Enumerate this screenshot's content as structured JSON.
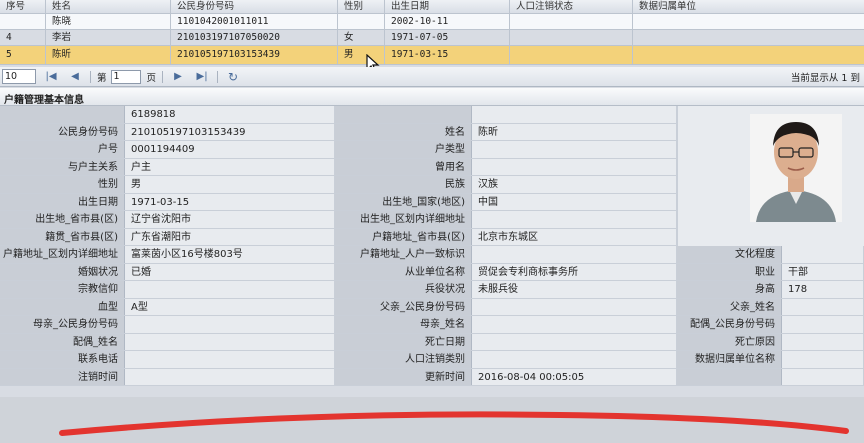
{
  "grid": {
    "headers": [
      "序号",
      "姓名",
      "公民身份号码",
      "性别",
      "出生日期",
      "人口注销状态",
      "数据归属单位"
    ],
    "rows": [
      {
        "idx": "",
        "name": "陈晓",
        "id": "1101042001011011",
        "sex": "",
        "dob": "2002-10-11",
        "status": "",
        "unit": ""
      },
      {
        "idx": "4",
        "name": "李岩",
        "id": "210103197107050020",
        "sex": "女",
        "dob": "1971-07-05",
        "status": "",
        "unit": ""
      },
      {
        "idx": "5",
        "name": "陈昕",
        "id": "210105197103153439",
        "sex": "男",
        "dob": "1971-03-15",
        "status": "",
        "unit": ""
      }
    ]
  },
  "pager": {
    "page_size": "10",
    "page_label": "第",
    "page_value": "1",
    "page_suffix": "页",
    "info": "当前显示从 1 到"
  },
  "section_title": "户籍管理基本信息",
  "form": [
    [
      {
        "l": "",
        "v": "6189818"
      },
      {
        "l": "",
        "v": ""
      }
    ],
    [
      {
        "l": "公民身份号码",
        "v": "210105197103153439"
      },
      {
        "l": "姓名",
        "v": "陈昕"
      }
    ],
    [
      {
        "l": "户号",
        "v": "0001194409"
      },
      {
        "l": "户类型",
        "v": ""
      }
    ],
    [
      {
        "l": "与户主关系",
        "v": "户主"
      },
      {
        "l": "曾用名",
        "v": ""
      }
    ],
    [
      {
        "l": "性别",
        "v": "男"
      },
      {
        "l": "民族",
        "v": "汉族"
      }
    ],
    [
      {
        "l": "出生日期",
        "v": "1971-03-15"
      },
      {
        "l": "出生地_国家(地区)",
        "v": "中国"
      }
    ],
    [
      {
        "l": "出生地_省市县(区)",
        "v": "辽宁省沈阳市"
      },
      {
        "l": "出生地_区划内详细地址",
        "v": ""
      }
    ],
    [
      {
        "l": "籍贯_省市县(区)",
        "v": "广东省潮阳市"
      },
      {
        "l": "户籍地址_省市县(区)",
        "v": "北京市东城区"
      }
    ],
    [
      {
        "l": "户籍地址_区划内详细地址",
        "v": "富莱茵小区16号楼803号"
      },
      {
        "l": "户籍地址_人户一致标识",
        "v": ""
      },
      {
        "l": "文化程度",
        "v": ""
      }
    ],
    [
      {
        "l": "婚姻状况",
        "v": "已婚"
      },
      {
        "l": "从业单位名称",
        "v": "贸促会专利商标事务所"
      },
      {
        "l": "职业",
        "v": "干部"
      }
    ],
    [
      {
        "l": "宗教信仰",
        "v": ""
      },
      {
        "l": "兵役状况",
        "v": "未服兵役"
      },
      {
        "l": "身高",
        "v": "178"
      }
    ],
    [
      {
        "l": "血型",
        "v": "A型"
      },
      {
        "l": "父亲_公民身份号码",
        "v": ""
      },
      {
        "l": "父亲_姓名",
        "v": ""
      }
    ],
    [
      {
        "l": "母亲_公民身份号码",
        "v": ""
      },
      {
        "l": "母亲_姓名",
        "v": ""
      },
      {
        "l": "配偶_公民身份号码",
        "v": ""
      }
    ],
    [
      {
        "l": "配偶_姓名",
        "v": ""
      },
      {
        "l": "死亡日期",
        "v": ""
      },
      {
        "l": "死亡原因",
        "v": ""
      }
    ],
    [
      {
        "l": "联系电话",
        "v": ""
      },
      {
        "l": "人口注销类别",
        "v": ""
      },
      {
        "l": "数据归属单位名称",
        "v": ""
      }
    ],
    [
      {
        "l": "注销时间",
        "v": ""
      },
      {
        "l": "更新时间",
        "v": "2016-08-04 00:05:05"
      },
      {
        "l": "",
        "v": ""
      }
    ]
  ],
  "colors": {
    "selected_row": "#f3d27a",
    "label_bg": "#c9ced6",
    "value_bg": "#e8ebef",
    "annotation": "#e3342f"
  }
}
